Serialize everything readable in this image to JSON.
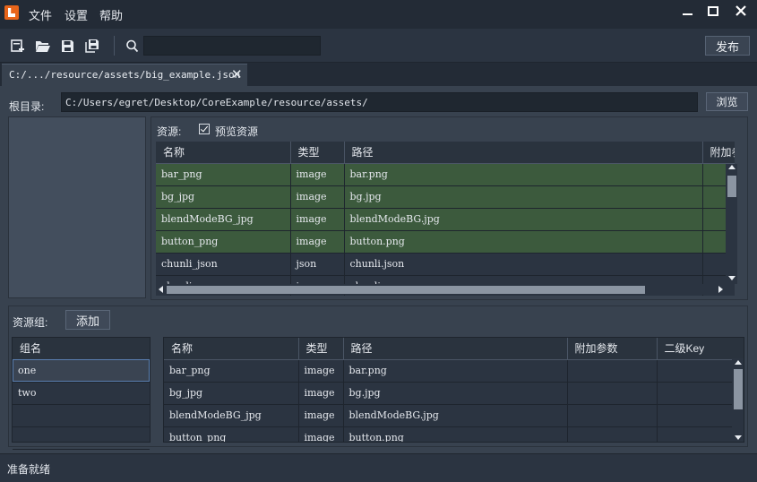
{
  "menu": [
    "文件",
    "设置",
    "帮助"
  ],
  "window_controls": {
    "minimize": "—",
    "maximize": "☐",
    "close": "✕"
  },
  "toolbar": {
    "search_value": "",
    "publish_label": "发布"
  },
  "tab": {
    "label": "C:/.../resource/assets/big_example.json",
    "close": "✕"
  },
  "root": {
    "label": "根目录:",
    "path": "C:/Users/egret/Desktop/CoreExample/resource/assets/",
    "browse_label": "浏览"
  },
  "resources": {
    "label": "资源:",
    "preview_label": "预览资源",
    "preview_checked": true,
    "columns": [
      "名称",
      "类型",
      "路径",
      "附加参"
    ],
    "rows": [
      {
        "name": "bar_png",
        "type": "image",
        "path": "bar.png",
        "highlighted": true
      },
      {
        "name": "bg_jpg",
        "type": "image",
        "path": "bg.jpg",
        "highlighted": true
      },
      {
        "name": "blendModeBG_jpg",
        "type": "image",
        "path": "blendModeBG.jpg",
        "highlighted": true
      },
      {
        "name": "button_png",
        "type": "image",
        "path": "button.png",
        "highlighted": true
      },
      {
        "name": "chunli_json",
        "type": "json",
        "path": "chunli.json",
        "highlighted": false
      },
      {
        "name": "chunli_png",
        "type": "image",
        "path": "chunli.png",
        "highlighted": false
      }
    ]
  },
  "groups": {
    "label": "资源组:",
    "add_label": "添加",
    "list_header": "组名",
    "list": [
      "one",
      "two"
    ],
    "selected": "one",
    "columns": [
      "名称",
      "类型",
      "路径",
      "附加参数",
      "二级Key"
    ],
    "rows": [
      {
        "name": "bar_png",
        "type": "image",
        "path": "bar.png"
      },
      {
        "name": "bg_jpg",
        "type": "image",
        "path": "bg.jpg"
      },
      {
        "name": "blendModeBG_jpg",
        "type": "image",
        "path": "blendModeBG.jpg"
      },
      {
        "name": "button_png",
        "type": "image",
        "path": "button.png"
      }
    ]
  },
  "status": "准备就绪",
  "colors": {
    "highlight_row": "#3c5a3d",
    "accent_logo": "#e8651a"
  }
}
